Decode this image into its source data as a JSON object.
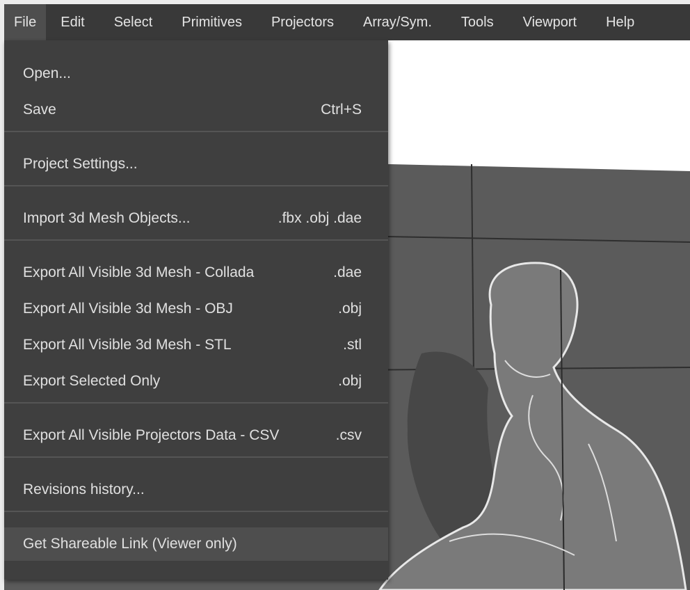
{
  "menubar": {
    "items": [
      {
        "label": "File",
        "active": true
      },
      {
        "label": "Edit"
      },
      {
        "label": "Select"
      },
      {
        "label": "Primitives"
      },
      {
        "label": "Projectors"
      },
      {
        "label": "Array/Sym."
      },
      {
        "label": "Tools"
      },
      {
        "label": "Viewport"
      },
      {
        "label": "Help"
      }
    ]
  },
  "file_menu": {
    "groups": [
      [
        {
          "label": "Open...",
          "accel": ""
        },
        {
          "label": "Save",
          "accel": "Ctrl+S"
        }
      ],
      [
        {
          "label": "Project Settings...",
          "accel": ""
        }
      ],
      [
        {
          "label": "Import 3d Mesh Objects...",
          "accel": ".fbx .obj .dae"
        }
      ],
      [
        {
          "label": "Export All Visible 3d Mesh - Collada",
          "accel": ".dae"
        },
        {
          "label": "Export All Visible 3d Mesh - OBJ",
          "accel": ".obj"
        },
        {
          "label": "Export All Visible 3d Mesh - STL",
          "accel": ".stl"
        },
        {
          "label": "Export Selected Only",
          "accel": ".obj"
        }
      ],
      [
        {
          "label": "Export All Visible Projectors Data - CSV",
          "accel": ".csv"
        }
      ],
      [
        {
          "label": "Revisions history...",
          "accel": ""
        }
      ],
      [
        {
          "label": "Get Shareable Link (Viewer only)",
          "accel": "",
          "highlighted": true
        }
      ]
    ]
  },
  "colors": {
    "menubar_bg": "#393939",
    "menu_bg": "#3f3f3f",
    "menu_highlight": "#4e4e4e",
    "viewport_bg": "#ffffff",
    "wall": "#5c5c5c"
  }
}
